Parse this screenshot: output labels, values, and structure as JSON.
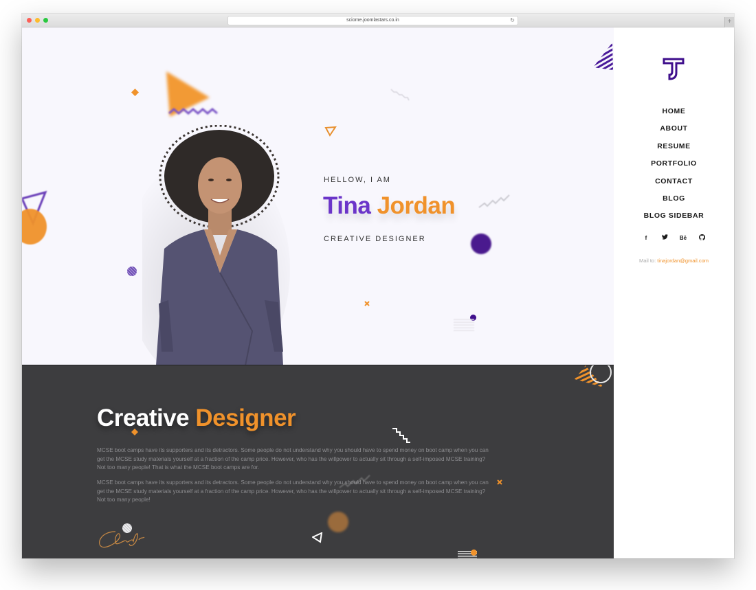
{
  "browser": {
    "url": "sciome.joomlastars.co.in",
    "reload_icon": "↻",
    "new_tab_icon": "+"
  },
  "hero": {
    "greeting": "HELLOW, I AM",
    "first_name": "Tina",
    "last_name": "Jordan",
    "role": "CREATIVE DESIGNER"
  },
  "about": {
    "title_white": "Creative",
    "title_orange": "Designer",
    "paragraphs": [
      "MCSE boot camps have its supporters and its detractors. Some people do not understand why you should have to spend money on boot camp when you can get the MCSE study materials yourself at a fraction of the camp price. However, who has the willpower to actually sit through a self-imposed MCSE training? Not too many people! That is what the MCSE boot camps are for.",
      "MCSE boot camps have its supporters and its detractors. Some people do not understand why you should have to spend money on boot camp when you can get the MCSE study materials yourself at a fraction of the camp price. However, who has the willpower to actually sit through a self-imposed MCSE training? Not too many people!"
    ]
  },
  "sidebar": {
    "logo_letters": "TJ",
    "nav": [
      {
        "label": "HOME"
      },
      {
        "label": "ABOUT"
      },
      {
        "label": "RESUME"
      },
      {
        "label": "PORTFOLIO"
      },
      {
        "label": "CONTACT"
      },
      {
        "label": "BLOG"
      },
      {
        "label": "BLOG SIDEBAR"
      }
    ],
    "social": [
      {
        "name": "facebook-icon",
        "glyph": "f"
      },
      {
        "name": "twitter-icon",
        "glyph": "🐦"
      },
      {
        "name": "behance-icon",
        "glyph": "Bē"
      },
      {
        "name": "github-icon",
        "glyph": "◯"
      }
    ],
    "mail_label": "Mail to:",
    "mail_address": "tinajordan@gmail.com"
  },
  "colors": {
    "purple": "#6b35c9",
    "deep_purple": "#3f0f8c",
    "orange": "#f0922b",
    "dark_bg": "#3d3d3f",
    "hero_bg": "#f8f7fd"
  }
}
